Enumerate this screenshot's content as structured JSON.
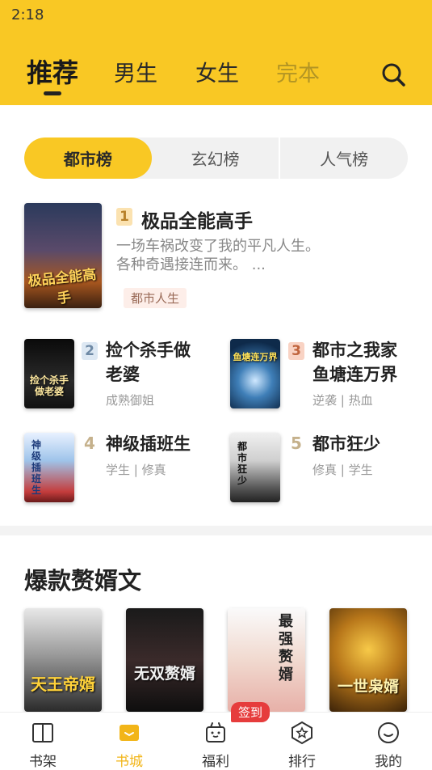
{
  "status_bar": {
    "time": "2:18"
  },
  "top_tabs": [
    "推荐",
    "男生",
    "女生",
    "完本"
  ],
  "segments": [
    "都市榜",
    "玄幻榜",
    "人气榜"
  ],
  "ranking": [
    {
      "rank": "1",
      "title": "极品全能高手",
      "desc": "一场车祸改变了我的平凡人生。各种奇遇接连而来。 ...",
      "tag": "都市人生",
      "cover_text": "极品全能高手"
    },
    {
      "rank": "2",
      "title": "捡个杀手做老婆",
      "tags": "成熟御姐",
      "cover_text": "捡个杀手做老婆"
    },
    {
      "rank": "3",
      "title": "都市之我家鱼塘连万界",
      "tags": "逆袭 | 热血",
      "cover_text": "鱼塘连万界"
    },
    {
      "rank": "4",
      "title": "神级插班生",
      "tags": "学生 | 修真",
      "cover_text": "神级插班生"
    },
    {
      "rank": "5",
      "title": "都市狂少",
      "tags": "修真 | 学生",
      "cover_text": "都市狂少"
    }
  ],
  "section": {
    "title": "爆款赘婿文"
  },
  "section_books": [
    {
      "cover_text": "天王帝婿"
    },
    {
      "cover_text": "无双赘婿"
    },
    {
      "cover_text": "最强赘婿"
    },
    {
      "cover_text": "一世枭婿"
    }
  ],
  "tabbar": {
    "items": [
      "书架",
      "书城",
      "福利",
      "排行",
      "我的"
    ],
    "sign_badge": "签到"
  },
  "colors": {
    "accent": "#f9c824",
    "active_tab": "#f2b518",
    "badge": "#e63c3c"
  }
}
